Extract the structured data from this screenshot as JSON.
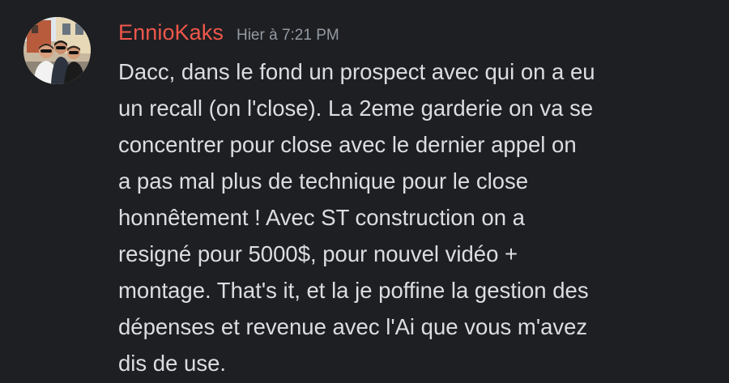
{
  "message": {
    "author": "EnnioKaks",
    "timestamp": "Hier à 7:21 PM",
    "author_color": "#f0574b",
    "lines": [
      "Dacc, dans le fond un prospect avec qui on a eu",
      "un recall (on l'close). La 2eme garderie on va se",
      "concentrer pour close avec le dernier appel on",
      "a pas mal plus de technique pour le close",
      "honnêtement ! Avec ST construction on a",
      "resigné pour 5000$, pour nouvel vidéo +",
      "montage. That's it, et la je poffine la gestion des",
      "dépenses et revenue avec l'Ai que vous m'avez",
      "dis de use."
    ]
  },
  "colors": {
    "background": "#1e1f22",
    "text": "#dbdee1",
    "timestamp": "#949ba4"
  }
}
